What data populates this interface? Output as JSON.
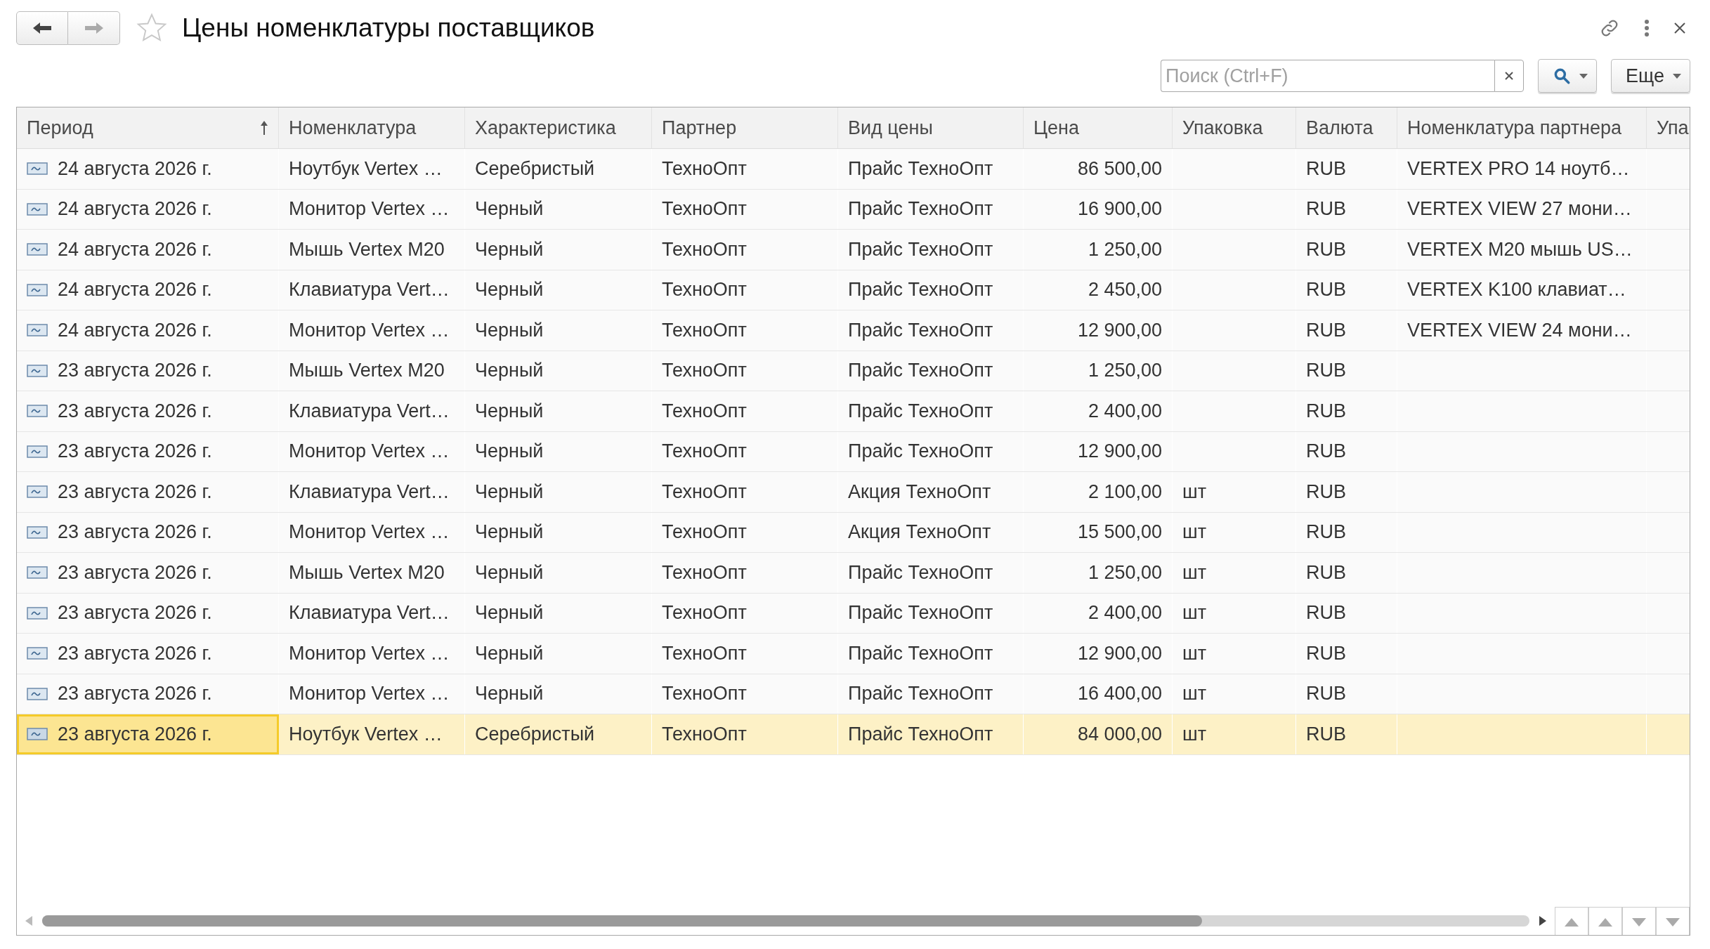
{
  "window": {
    "title": "Цены номенклатуры поставщиков",
    "back_disabled": false,
    "forward_disabled": true,
    "favorite": false
  },
  "search": {
    "placeholder": "Поиск (Ctrl+F)"
  },
  "more_button": {
    "label": "Еще"
  },
  "table": {
    "columns": [
      {
        "label": "Период",
        "sorted": true
      },
      {
        "label": "Номенклатура",
        "sorted": false
      },
      {
        "label": "Характеристика",
        "sorted": false
      },
      {
        "label": "Партнер",
        "sorted": false
      },
      {
        "label": "Вид цены",
        "sorted": false
      },
      {
        "label": "Цена",
        "sorted": false
      },
      {
        "label": "Упаковка",
        "sorted": false
      },
      {
        "label": "Валюта",
        "sorted": false
      },
      {
        "label": "Номенклатура партнера",
        "sorted": false
      },
      {
        "label": "Упа",
        "sorted": false
      }
    ],
    "rows": [
      {
        "selected": false,
        "period": "24 августа 2026 г.",
        "item": "Ноутбук Vertex …",
        "characteristic": "Серебристый",
        "partner": "ТехноОпт",
        "price_type": "Прайс ТехноОпт",
        "price": "86 500,00",
        "currency": "RUB",
        "partner_item": "VERTEX PRO 14 ноутб…"
      },
      {
        "selected": false,
        "period": "24 августа 2026 г.",
        "item": "Монитор Vertex …",
        "characteristic": "Черный",
        "partner": "ТехноОпт",
        "price_type": "Прайс ТехноОпт",
        "price": "16 900,00",
        "currency": "RUB",
        "partner_item": "VERTEX VIEW 27 мони…"
      },
      {
        "selected": false,
        "period": "24 августа 2026 г.",
        "item": "Мышь Vertex M20",
        "characteristic": "Черный",
        "partner": "ТехноОпт",
        "price_type": "Прайс ТехноОпт",
        "price": "1 250,00",
        "currency": "RUB",
        "partner_item": "VERTEX M20 мышь US…"
      },
      {
        "selected": false,
        "period": "24 августа 2026 г.",
        "item": "Клавиатура Vert…",
        "characteristic": "Черный",
        "partner": "ТехноОпт",
        "price_type": "Прайс ТехноОпт",
        "price": "2 450,00",
        "currency": "RUB",
        "partner_item": "VERTEX K100 клавиат…"
      },
      {
        "selected": false,
        "period": "24 августа 2026 г.",
        "item": "Монитор Vertex …",
        "characteristic": "Черный",
        "partner": "ТехноОпт",
        "price_type": "Прайс ТехноОпт",
        "price": "12 900,00",
        "currency": "RUB",
        "partner_item": "VERTEX VIEW 24 мони…"
      },
      {
        "selected": false,
        "period": "23 августа 2026 г.",
        "item": "Мышь Vertex M20",
        "characteristic": "Черный",
        "partner": "ТехноОпт",
        "price_type": "Прайс ТехноОпт",
        "price": "1 250,00",
        "currency": "RUB"
      },
      {
        "selected": false,
        "period": "23 августа 2026 г.",
        "item": "Клавиатура Vert…",
        "characteristic": "Черный",
        "partner": "ТехноОпт",
        "price_type": "Прайс ТехноОпт",
        "price": "2 400,00",
        "currency": "RUB"
      },
      {
        "selected": false,
        "period": "23 августа 2026 г.",
        "item": "Монитор Vertex …",
        "characteristic": "Черный",
        "partner": "ТехноОпт",
        "price_type": "Прайс ТехноОпт",
        "price": "12 900,00",
        "currency": "RUB"
      },
      {
        "selected": false,
        "period": "23 августа 2026 г.",
        "item": "Клавиатура Vert…",
        "characteristic": "Черный",
        "partner": "ТехноОпт",
        "price_type": "Акция ТехноОпт",
        "price": "2 100,00",
        "package": "шт",
        "currency": "RUB"
      },
      {
        "selected": false,
        "period": "23 августа 2026 г.",
        "item": "Монитор Vertex …",
        "characteristic": "Черный",
        "partner": "ТехноОпт",
        "price_type": "Акция ТехноОпт",
        "price": "15 500,00",
        "package": "шт",
        "currency": "RUB"
      },
      {
        "selected": false,
        "period": "23 августа 2026 г.",
        "item": "Мышь Vertex M20",
        "characteristic": "Черный",
        "partner": "ТехноОпт",
        "price_type": "Прайс ТехноОпт",
        "price": "1 250,00",
        "package": "шт",
        "currency": "RUB"
      },
      {
        "selected": false,
        "period": "23 августа 2026 г.",
        "item": "Клавиатура Vert…",
        "characteristic": "Черный",
        "partner": "ТехноОпт",
        "price_type": "Прайс ТехноОпт",
        "price": "2 400,00",
        "package": "шт",
        "currency": "RUB"
      },
      {
        "selected": false,
        "period": "23 августа 2026 г.",
        "item": "Монитор Vertex …",
        "characteristic": "Черный",
        "partner": "ТехноОпт",
        "price_type": "Прайс ТехноОпт",
        "price": "12 900,00",
        "package": "шт",
        "currency": "RUB"
      },
      {
        "selected": false,
        "period": "23 августа 2026 г.",
        "item": "Монитор Vertex …",
        "characteristic": "Черный",
        "partner": "ТехноОпт",
        "price_type": "Прайс ТехноОпт",
        "price": "16 400,00",
        "package": "шт",
        "currency": "RUB"
      },
      {
        "selected": true,
        "period": "23 августа 2026 г.",
        "item": "Ноутбук Vertex …",
        "characteristic": "Серебристый",
        "partner": "ТехноОпт",
        "price_type": "Прайс ТехноОпт",
        "price": "84 000,00",
        "package": "шт",
        "currency": "RUB"
      }
    ]
  }
}
